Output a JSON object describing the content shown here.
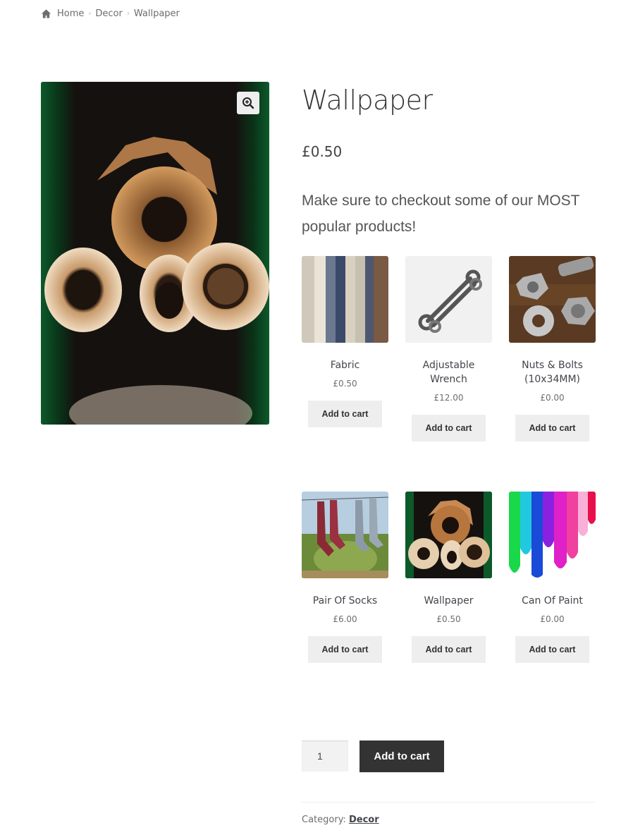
{
  "breadcrumb": {
    "home": "Home",
    "category": "Decor",
    "current": "Wallpaper"
  },
  "product": {
    "title": "Wallpaper",
    "price": "£0.50",
    "promo": "Make sure to checkout some of our MOST popular products!",
    "quantity": "1",
    "add_to_cart": "Add to cart",
    "category_label": "Category:",
    "category": "Decor"
  },
  "related": [
    {
      "name": "Fabric",
      "price": "£0.50",
      "button": "Add to cart"
    },
    {
      "name": "Adjustable Wrench",
      "price": "£12.00",
      "button": "Add to cart"
    },
    {
      "name": "Nuts & Bolts (10x34MM)",
      "price": "£0.00",
      "button": "Add to cart"
    },
    {
      "name": "Pair Of Socks",
      "price": "£6.00",
      "button": "Add to cart"
    },
    {
      "name": "Wallpaper",
      "price": "£0.50",
      "button": "Add to cart"
    },
    {
      "name": "Can Of Paint",
      "price": "£0.00",
      "button": "Add to cart"
    }
  ],
  "icons": {
    "home": "home-icon",
    "zoom": "zoom-in-icon",
    "separator": "chevron-right-icon"
  },
  "colors": {
    "button_dark": "#333333",
    "button_light": "#eeeeee",
    "text": "#43454b"
  }
}
